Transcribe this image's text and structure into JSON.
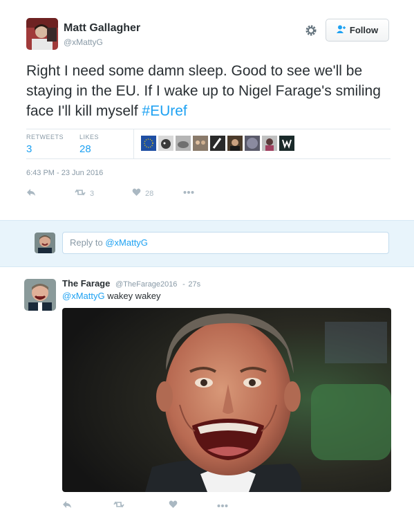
{
  "tweet": {
    "author_name": "Matt Gallagher",
    "author_handle": "@xMattyG",
    "follow_label": "Follow",
    "text": "Right I need some damn sleep. Good to see we'll be staying in the EU. If I wake up to Nigel Farage's smiling face I'll kill myself",
    "hashtag": "#EUref",
    "retweets_label": "RETWEETS",
    "retweets_count": "3",
    "likes_label": "LIKES",
    "likes_count": "28",
    "timestamp": "6:43 PM - 23 Jun 2016",
    "action_retweet_count": "3",
    "action_like_count": "28",
    "likers": [
      "eu-flag",
      "dog-photo",
      "cat-photo",
      "group-photo",
      "selfie",
      "couple-photo",
      "round-avatar",
      "portrait-photo",
      "w-logo"
    ]
  },
  "reply_box": {
    "reply_to_prefix": "Reply to",
    "mention": "@xMattyG"
  },
  "reply": {
    "author_name": "The Farage",
    "author_handle": "@TheFarage2016",
    "time_ago": "27s",
    "mention": "@xMattyG",
    "text": "wakey wakey"
  },
  "colors": {
    "link_blue": "#1da1f2",
    "muted_grey": "#8899a6",
    "reply_band": "#e8f4fb"
  }
}
